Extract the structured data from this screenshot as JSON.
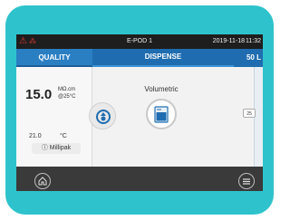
{
  "status_bar": {
    "device": "E-POD 1",
    "date": "2019-11-18",
    "time": "11:32"
  },
  "tabs": {
    "quality": "QUALITY",
    "dispense": "DISPENSE",
    "volume": "50 L"
  },
  "quality_panel": {
    "resistivity_value": "15.0",
    "resistivity_unit": "MΩ.cm",
    "reference_temp": "@25°C",
    "temperature_value": "21.0",
    "temperature_unit": "°C",
    "pak_label": "Millipak"
  },
  "dispense": {
    "mode_label": "Volumetric"
  },
  "slider": {
    "badge": "25"
  },
  "icons": {
    "alert": "alert-icon",
    "network": "network-icon",
    "recirculation": "recirculation-icon",
    "volumetric": "volumetric-icon",
    "home": "home-icon",
    "menu": "menu-icon",
    "info": "info-icon"
  },
  "colors": {
    "frame": "#2ec3cc",
    "tab_bar": "#1f6db0",
    "alert": "#e53935",
    "bottom_bar": "#3a3a3a"
  }
}
